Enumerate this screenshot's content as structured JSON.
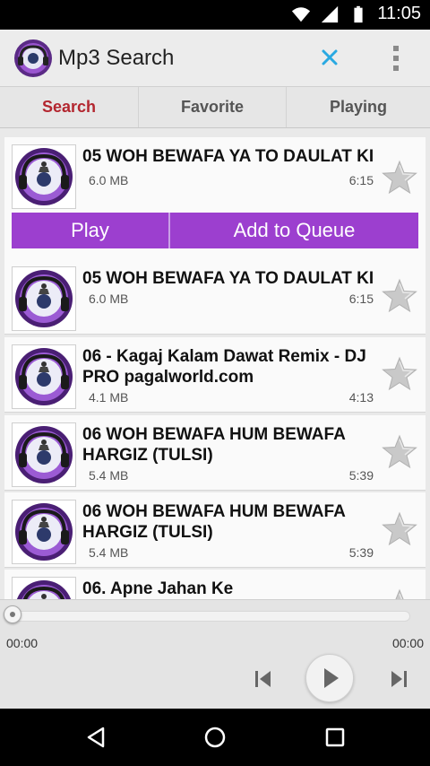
{
  "status_bar": {
    "time": "11:05"
  },
  "app_bar": {
    "title": "Mp3 Search"
  },
  "tabs": [
    {
      "label": "Search",
      "active": true
    },
    {
      "label": "Favorite",
      "active": false
    },
    {
      "label": "Playing",
      "active": false
    }
  ],
  "songs": [
    {
      "title": "05 WOH BEWAFA YA TO DAULAT KI",
      "size": "6.0 MB",
      "duration": "6:15"
    },
    {
      "title": "05 WOH BEWAFA YA TO DAULAT KI",
      "size": "6.0 MB",
      "duration": "6:15"
    },
    {
      "title": "06 - Kagaj Kalam Dawat Remix - DJ PRO pagalworld.com",
      "size": "4.1 MB",
      "duration": "4:13"
    },
    {
      "title": "06 WOH BEWAFA HUM BEWAFA HARGIZ (TULSI)",
      "size": "5.4 MB",
      "duration": "5:39"
    },
    {
      "title": "06 WOH BEWAFA HUM BEWAFA HARGIZ (TULSI)",
      "size": "5.4 MB",
      "duration": "5:39"
    },
    {
      "title": "06. Apne Jahan Ke",
      "size": "",
      "duration": ""
    }
  ],
  "actions": {
    "play_label": "Play",
    "queue_label": "Add to Queue"
  },
  "player": {
    "elapsed": "00:00",
    "total": "00:00",
    "progress": 0
  },
  "colors": {
    "accent": "#9c3fcf",
    "active_tab": "#b3262f",
    "close_icon": "#29a9e1"
  },
  "icons": [
    "wifi-icon",
    "signal-icon",
    "battery-icon",
    "app-logo-icon",
    "close-icon",
    "overflow-menu-icon",
    "star-icon",
    "previous-track-icon",
    "play-icon",
    "next-track-icon",
    "back-icon",
    "home-icon",
    "recents-icon"
  ]
}
